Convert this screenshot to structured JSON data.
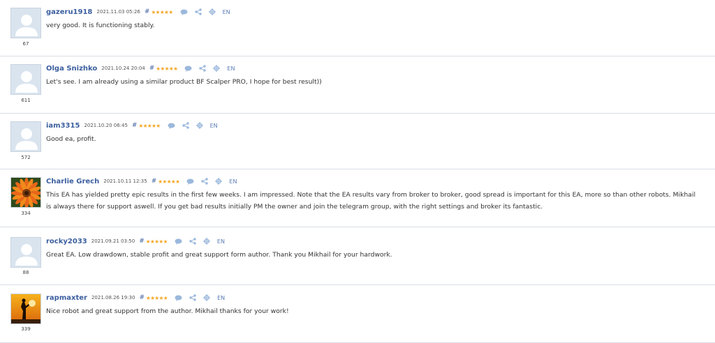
{
  "reviews": [
    {
      "author": "gazeru1918",
      "date": "2021.11.03 05:26",
      "hash": "#",
      "stars": "★★★★★",
      "lang": "EN",
      "avatar": "default-user",
      "rating_count": "67",
      "text": "very good. It is functioning stably."
    },
    {
      "author": "Olga Snizhko",
      "date": "2021.10.24 20:04",
      "hash": "#",
      "stars": "★★★★★",
      "lang": "EN",
      "avatar": "default-user",
      "rating_count": "611",
      "text": "Let's see. I am already using a similar product BF Scalper PRO, I hope for best result))"
    },
    {
      "author": "iam3315",
      "date": "2021.10.20 06:45",
      "hash": "#",
      "stars": "★★★★★",
      "lang": "EN",
      "avatar": "default-user",
      "rating_count": "572",
      "text": "Good ea, profit."
    },
    {
      "author": "Charlie Grech",
      "date": "2021.10.11 12:35",
      "hash": "#",
      "stars": "★★★★★",
      "lang": "EN",
      "avatar": "orange-flower",
      "rating_count": "334",
      "text": "This EA has yielded pretty epic results in the first few weeks. I am impressed. Note that the EA results vary from broker to broker, good spread is important for this EA, more so than other robots. Mikhail is always there for support aswell. If you get bad results initially PM the owner and join the telegram group, with the right settings and broker its fantastic."
    },
    {
      "author": "rocky2033",
      "date": "2021.09.21 03:50",
      "hash": "#",
      "stars": "★★★★★",
      "lang": "EN",
      "avatar": "default-user",
      "rating_count": "88",
      "text": "Great EA. Low drawdown, stable profit and great support form author. Thank you Mikhail for your hardwork."
    },
    {
      "author": "rapmaxter",
      "date": "2021.08.26 19:30",
      "hash": "#",
      "stars": "★★★★★",
      "lang": "EN",
      "avatar": "sunset-silhouette",
      "rating_count": "339",
      "text": "Nice robot and great support from the author. Mikhail thanks for your work!"
    }
  ],
  "icons": {
    "comment": "comment-icon",
    "share": "share-icon",
    "translate": "translate-icon"
  },
  "colors": {
    "author_link": "#3b5e9e",
    "stars": "#f5a623",
    "icon": "#8fb0d8",
    "divider": "#d9dde4"
  }
}
